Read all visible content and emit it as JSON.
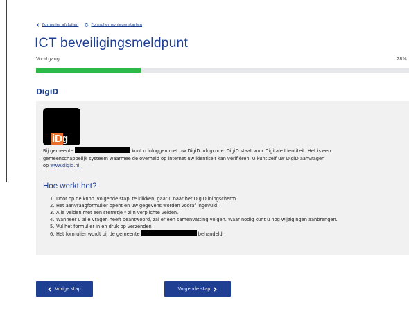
{
  "nav": {
    "close_label": "Formulier afsluiten",
    "restart_label": "Formulier opnieuw starten"
  },
  "page": {
    "title": "ICT beveiligingsmeldpunt",
    "progress_label": "Voortgang",
    "progress_percent_text": "28%",
    "progress_fraction": 0.28
  },
  "section": {
    "heading": "DigiD",
    "logo": {
      "dig": "Dig",
      "id": "iD"
    },
    "intro": {
      "line1_before": "Bij gemeente",
      "line1_after": "kunt u inloggen met uw DigiD inlogcode. DigiD staat voor Digitale Identiteit. Het is een",
      "line2": "gemeenschappelijk systeem waarmee de overheid op internet uw identiteit kan verifiëren. U kunt zelf uw DigiD aanvragen",
      "line3_before": "op",
      "link": "www.digid.nl",
      "line3_after": "."
    },
    "how_heading": "Hoe werkt het?",
    "steps": [
      {
        "num": "1.",
        "text": "Door op de knop 'volgende stap' te klikken, gaat u naar het DigiD inlogscherm."
      },
      {
        "num": "2.",
        "text": "Het aanvraagformulier opent en uw gegevens worden vooraf ingevuld."
      },
      {
        "num": "3.",
        "text": "Alle velden met een sterretje * zijn verplichte velden."
      },
      {
        "num": "4.",
        "text": "Wanneer u alle vragen heeft beantwoord, zal er een samenvatting volgen. Waar nodig kunt u nog wijzigingen aanbrengen."
      },
      {
        "num": "5.",
        "text": "Vul het formulier in en druk op verzenden"
      },
      {
        "num": "6.",
        "before": "Het formulier wordt bij de gemeente",
        "after": "behandeld."
      }
    ]
  },
  "buttons": {
    "prev": "Vorige stap",
    "next": "Volgende stap"
  },
  "colors": {
    "brand_blue": "#1e3f92",
    "progress_green": "#2db84a",
    "digid_orange": "#e8702a"
  }
}
